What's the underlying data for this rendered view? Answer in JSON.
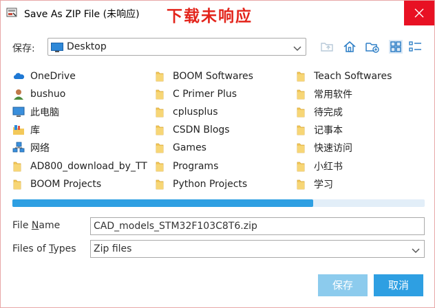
{
  "titlebar": {
    "title": "Save As ZIP File (未响应)",
    "annotation": "下载未响应",
    "close_glyph": "✕"
  },
  "toolbar": {
    "save_in_label": "保存:",
    "location": "Desktop",
    "icons": [
      "up-folder-icon",
      "home-icon",
      "new-folder-icon",
      "list-view-icon",
      "details-view-icon"
    ]
  },
  "files": {
    "col1": [
      {
        "label": "OneDrive",
        "icon": "onedrive-cloud-icon"
      },
      {
        "label": "bushuo",
        "icon": "user-icon"
      },
      {
        "label": "此电脑",
        "icon": "computer-icon"
      },
      {
        "label": "库",
        "icon": "library-icon"
      },
      {
        "label": "网络",
        "icon": "network-icon"
      },
      {
        "label": "AD800_download_by_TT",
        "icon": "folder-icon"
      },
      {
        "label": "BOOM Projects",
        "icon": "folder-icon"
      }
    ],
    "col2": [
      {
        "label": "BOOM Softwares",
        "icon": "folder-icon"
      },
      {
        "label": "C Primer Plus",
        "icon": "folder-icon"
      },
      {
        "label": "cplusplus",
        "icon": "folder-icon"
      },
      {
        "label": "CSDN Blogs",
        "icon": "folder-icon"
      },
      {
        "label": "Games",
        "icon": "folder-icon"
      },
      {
        "label": "Programs",
        "icon": "folder-icon"
      },
      {
        "label": "Python Projects",
        "icon": "folder-icon"
      }
    ],
    "col3": [
      {
        "label": "Teach Softwares",
        "icon": "folder-icon"
      },
      {
        "label": "常用软件",
        "icon": "folder-icon"
      },
      {
        "label": "待完成",
        "icon": "folder-icon"
      },
      {
        "label": "记事本",
        "icon": "folder-icon"
      },
      {
        "label": "快速访问",
        "icon": "folder-icon"
      },
      {
        "label": "小红书",
        "icon": "folder-icon"
      },
      {
        "label": "学习",
        "icon": "folder-icon"
      }
    ]
  },
  "scrollbar": {
    "position_fraction": 0.73
  },
  "form": {
    "file_name_label_pre": "File ",
    "file_name_label_underline": "N",
    "file_name_label_post": "ame",
    "file_name_value": "CAD_models_STM32F103C8T6.zip",
    "file_types_label_pre": "Files of ",
    "file_types_label_underline": "T",
    "file_types_label_post": "ypes",
    "file_type_value": "Zip files"
  },
  "buttons": {
    "save": "保存",
    "cancel": "取消"
  },
  "colors": {
    "accent": "#2e9fe2",
    "accent_disabled": "#8ccbed",
    "close": "#e81123",
    "annotation": "#e3241b",
    "folder": "#f3c95a"
  }
}
